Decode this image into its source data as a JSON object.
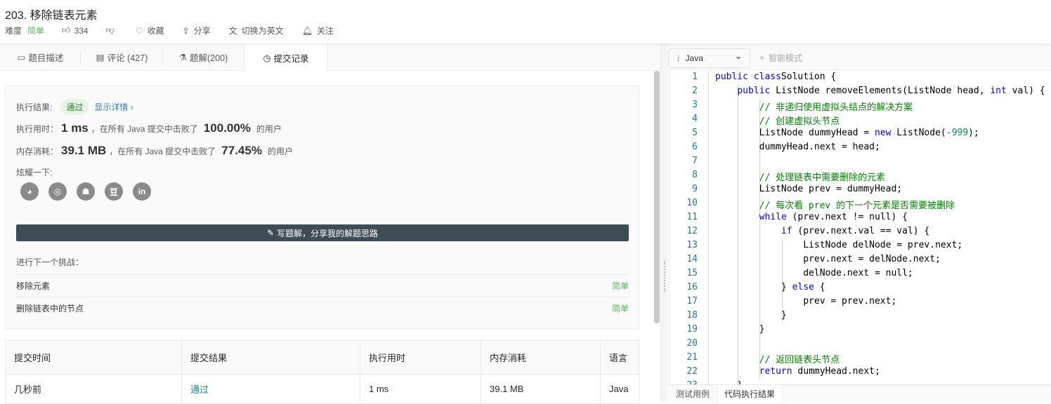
{
  "header": {
    "title": "203. 移除链表元素",
    "difficulty_label": "难度",
    "difficulty": "简单",
    "likes": "334",
    "favorite": "收藏",
    "share": "分享",
    "switch_lang": "切换为英文",
    "follow": "关注"
  },
  "tabs": [
    {
      "label": "题目描述"
    },
    {
      "label": "评论 (427)"
    },
    {
      "label": "题解(200)"
    },
    {
      "label": "提交记录"
    }
  ],
  "result": {
    "label": "执行结果:",
    "status": "通过",
    "details": "显示详情 ›",
    "time_label": "执行用时：",
    "time": "1 ms",
    "time_mid": "，在所有 Java 提交中击败了",
    "time_pct": "100.00%",
    "users": "的用户",
    "mem_label": "内存消耗：",
    "mem": "39.1 MB",
    "mem_mid": "，在所有 Java 提交中击败了",
    "mem_pct": "77.45%",
    "show_off": "炫耀一下:",
    "social": [
      "wechat",
      "weibo",
      "qq",
      "douban",
      "in"
    ],
    "write_button": "写题解，分享我的解题思路",
    "next_label": "进行下一个挑战：",
    "next": [
      {
        "name": "移除元素",
        "difficulty": "简单"
      },
      {
        "name": "删除链表中的节点",
        "difficulty": "简单"
      }
    ]
  },
  "table": {
    "headers": [
      "提交时间",
      "提交结果",
      "执行用时",
      "内存消耗",
      "语言"
    ],
    "rows": [
      [
        "几秒前",
        "通过",
        "1 ms",
        "39.1 MB",
        "Java"
      ]
    ]
  },
  "editor": {
    "language": "Java",
    "smart_mode": "智能模式",
    "bottom_tabs": [
      "测试用例",
      "代码执行结果"
    ],
    "lines": [
      [
        [
          "kw",
          "public class"
        ],
        [
          "",
          "Solution {"
        ]
      ],
      [
        [
          "",
          "    "
        ],
        [
          "kw",
          "public"
        ],
        [
          "",
          " ListNode removeElements(ListNode head, "
        ],
        [
          "kw",
          "int"
        ],
        [
          "",
          " val) {"
        ]
      ],
      [
        [
          "cm",
          "        // 非递归使用虚拟头结点的解决方案"
        ]
      ],
      [
        [
          "cm",
          "        // 创建虚拟头节点"
        ]
      ],
      [
        [
          "",
          "        ListNode dummyHead = "
        ],
        [
          "kw",
          "new"
        ],
        [
          "",
          " ListNode("
        ],
        [
          "nm",
          "-999"
        ],
        [
          "",
          ");"
        ]
      ],
      [
        [
          "",
          "        dummyHead.next = head;"
        ]
      ],
      [],
      [
        [
          "cm",
          "        // 处理链表中需要删除的元素"
        ]
      ],
      [
        [
          "",
          "        ListNode prev = dummyHead;"
        ]
      ],
      [
        [
          "cm",
          "        // 每次看 prev 的下一个元素是否需要被删除"
        ]
      ],
      [
        [
          "",
          "        "
        ],
        [
          "kw",
          "while"
        ],
        [
          "",
          " (prev.next != null) {"
        ]
      ],
      [
        [
          "",
          "            "
        ],
        [
          "kw",
          "if"
        ],
        [
          "",
          " (prev.next.val == val) {"
        ]
      ],
      [
        [
          "",
          "                ListNode delNode = prev.next;"
        ]
      ],
      [
        [
          "",
          "                prev.next = delNode.next;"
        ]
      ],
      [
        [
          "",
          "                delNode.next = null;"
        ]
      ],
      [
        [
          "",
          "            } "
        ],
        [
          "kw",
          "else"
        ],
        [
          "",
          " {"
        ]
      ],
      [
        [
          "",
          "                prev = prev.next;"
        ]
      ],
      [
        [
          "",
          "            }"
        ]
      ],
      [
        [
          "",
          "        }"
        ]
      ],
      [],
      [
        [
          "cm",
          "        // 返回链表头节点"
        ]
      ],
      [
        [
          "",
          "        "
        ],
        [
          "kw",
          "return"
        ],
        [
          "",
          " dummyHead.next;"
        ]
      ],
      [
        [
          "",
          "    }"
        ]
      ]
    ]
  }
}
